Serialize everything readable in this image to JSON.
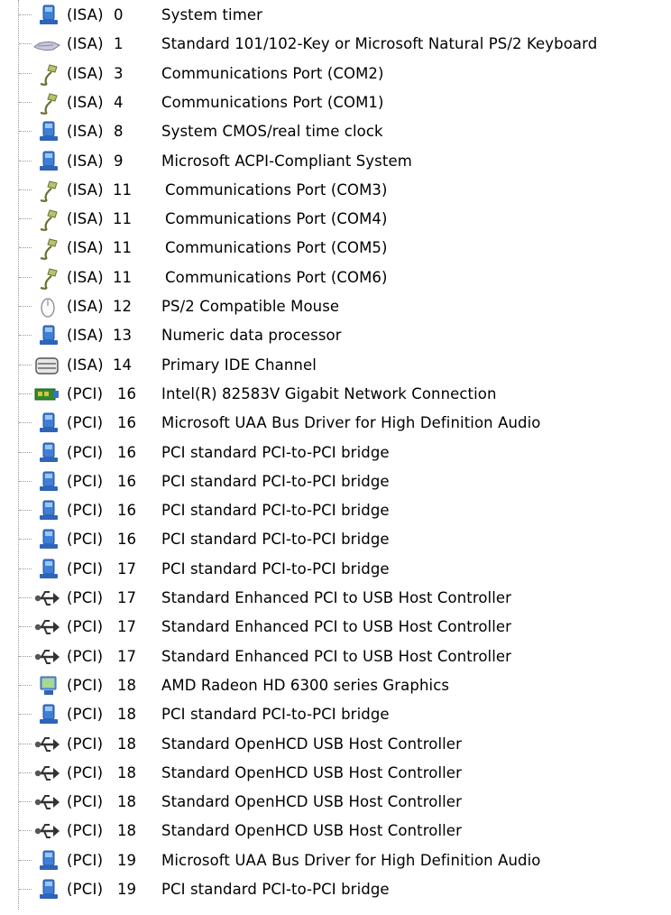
{
  "irq_list": {
    "rows": [
      {
        "bus": "(ISA)",
        "irq": "0",
        "name": "System timer",
        "icon": "system-device-icon"
      },
      {
        "bus": "(ISA)",
        "irq": "1",
        "name": "Standard 101/102-Key or Microsoft Natural PS/2 Keyboard",
        "icon": "keyboard-icon"
      },
      {
        "bus": "(ISA)",
        "irq": "3",
        "name": "Communications Port (COM2)",
        "icon": "port-connector-icon"
      },
      {
        "bus": "(ISA)",
        "irq": "4",
        "name": "Communications Port (COM1)",
        "icon": "port-connector-icon"
      },
      {
        "bus": "(ISA)",
        "irq": "8",
        "name": "System CMOS/real time clock",
        "icon": "system-device-icon"
      },
      {
        "bus": "(ISA)",
        "irq": "9",
        "name": "Microsoft ACPI-Compliant System",
        "icon": "system-device-icon"
      },
      {
        "bus": "(ISA)",
        "irq": "11",
        "name": "Communications Port (COM3)",
        "icon": "port-connector-icon"
      },
      {
        "bus": "(ISA)",
        "irq": "11",
        "name": "Communications Port (COM4)",
        "icon": "port-connector-icon"
      },
      {
        "bus": "(ISA)",
        "irq": "11",
        "name": "Communications Port (COM5)",
        "icon": "port-connector-icon"
      },
      {
        "bus": "(ISA)",
        "irq": "11",
        "name": "Communications Port (COM6)",
        "icon": "port-connector-icon"
      },
      {
        "bus": "(ISA)",
        "irq": "12",
        "name": "PS/2 Compatible Mouse",
        "icon": "mouse-icon"
      },
      {
        "bus": "(ISA)",
        "irq": "13",
        "name": "Numeric data processor",
        "icon": "system-device-icon"
      },
      {
        "bus": "(ISA)",
        "irq": "14",
        "name": "Primary IDE Channel",
        "icon": "ide-controller-icon"
      },
      {
        "bus": "(PCI)",
        "irq": "16",
        "name": "Intel(R) 82583V Gigabit Network Connection",
        "icon": "network-adapter-icon"
      },
      {
        "bus": "(PCI)",
        "irq": "16",
        "name": "Microsoft UAA Bus Driver for High Definition Audio",
        "icon": "system-device-icon"
      },
      {
        "bus": "(PCI)",
        "irq": "16",
        "name": "PCI standard PCI-to-PCI bridge",
        "icon": "system-device-icon"
      },
      {
        "bus": "(PCI)",
        "irq": "16",
        "name": "PCI standard PCI-to-PCI bridge",
        "icon": "system-device-icon"
      },
      {
        "bus": "(PCI)",
        "irq": "16",
        "name": "PCI standard PCI-to-PCI bridge",
        "icon": "system-device-icon"
      },
      {
        "bus": "(PCI)",
        "irq": "16",
        "name": "PCI standard PCI-to-PCI bridge",
        "icon": "system-device-icon"
      },
      {
        "bus": "(PCI)",
        "irq": "17",
        "name": "PCI standard PCI-to-PCI bridge",
        "icon": "system-device-icon"
      },
      {
        "bus": "(PCI)",
        "irq": "17",
        "name": "Standard Enhanced PCI to USB Host Controller",
        "icon": "usb-icon"
      },
      {
        "bus": "(PCI)",
        "irq": "17",
        "name": "Standard Enhanced PCI to USB Host Controller",
        "icon": "usb-icon"
      },
      {
        "bus": "(PCI)",
        "irq": "17",
        "name": "Standard Enhanced PCI to USB Host Controller",
        "icon": "usb-icon"
      },
      {
        "bus": "(PCI)",
        "irq": "18",
        "name": "AMD Radeon HD 6300 series Graphics",
        "icon": "display-adapter-icon"
      },
      {
        "bus": "(PCI)",
        "irq": "18",
        "name": "PCI standard PCI-to-PCI bridge",
        "icon": "system-device-icon"
      },
      {
        "bus": "(PCI)",
        "irq": "18",
        "name": "Standard OpenHCD USB Host Controller",
        "icon": "usb-icon"
      },
      {
        "bus": "(PCI)",
        "irq": "18",
        "name": "Standard OpenHCD USB Host Controller",
        "icon": "usb-icon"
      },
      {
        "bus": "(PCI)",
        "irq": "18",
        "name": "Standard OpenHCD USB Host Controller",
        "icon": "usb-icon"
      },
      {
        "bus": "(PCI)",
        "irq": "18",
        "name": "Standard OpenHCD USB Host Controller",
        "icon": "usb-icon"
      },
      {
        "bus": "(PCI)",
        "irq": "19",
        "name": "Microsoft UAA Bus Driver for High Definition Audio",
        "icon": "system-device-icon"
      },
      {
        "bus": "(PCI)",
        "irq": "19",
        "name": "PCI standard PCI-to-PCI bridge",
        "icon": "system-device-icon"
      }
    ]
  }
}
